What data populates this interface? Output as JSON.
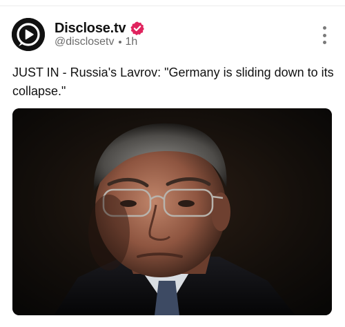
{
  "author": {
    "display_name": "Disclose.tv",
    "handle": "@disclosetv",
    "timestamp": "1h",
    "verified": true,
    "avatar_icon": "play-circle-logo-icon"
  },
  "post": {
    "text": "JUST IN - Russia's Lavrov: \"Germany is sliding down to its collapse.\""
  },
  "media": {
    "type": "photo"
  },
  "colors": {
    "verified_badge": "#e0245e",
    "text": "#111111",
    "muted": "#6b6b6b"
  },
  "icons": {
    "verified": "verified-badge-icon",
    "more": "more-options-icon"
  }
}
